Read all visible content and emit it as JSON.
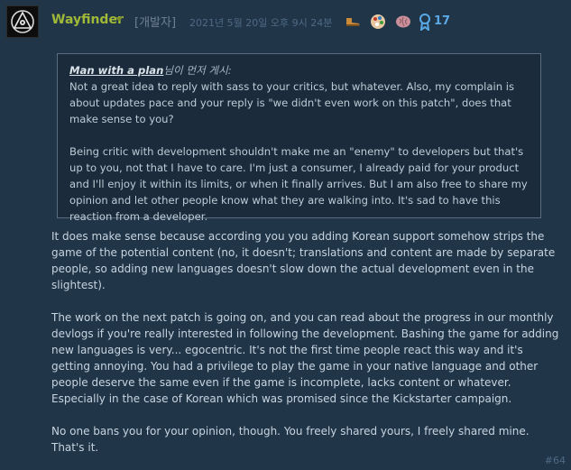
{
  "post": {
    "author": "Wayfinder",
    "role": "[개발자]",
    "date": "2021년 5월 20일 오후 9시 24분",
    "award_count": "17",
    "post_number": "#64"
  },
  "quote": {
    "author": "Man with a plan",
    "suffix": "님이 먼저 게시:",
    "paragraphs": [
      "Not a great idea to reply with sass to your critics, but whatever. Also, my complain is about updates pace and your reply is \"we didn't even work on this patch\", does that make sense to you?",
      "Being critic with development shouldn't make me an \"enemy\" to developers but that's up to you, not that I have to care. I'm just a consumer, I already paid for your product and I'll enjoy it within its limits, or when it finally arrives. But I am also free to share my opinion and let other people know what they are walking into. It's sad to have this reaction from a developer."
    ]
  },
  "body": {
    "paragraphs": [
      "It does make sense because according you you adding Korean support somehow strips the game of the potential content (no, it doesn't; translations and content are made by separate people, so adding new languages doesn't slow down the actual development even in the slightest).",
      "The work on the next patch is going on, and you can read about the progress in our monthly devlogs if you're really interested in following the development. Bashing the game for adding new languages is very... egocentric. It's not the first time people react this way and it's getting annoying. You had a privilege to play the game in your native language and other people deserve the same even if the game is incomplete, lacks content or whatever. Especially in the case of Korean which was promised since the Kickstarter campaign.",
      "No one bans you for your opinion, though. You freely shared yours, I freely shared mine. That's it."
    ]
  },
  "icons": [
    "avatar-emblem-icon",
    "boot-icon",
    "palette-icon",
    "brain-icon",
    "award-ribbon-icon"
  ],
  "colors": {
    "background": "#213549",
    "author": "#a0b936",
    "accent": "#5aa9e6"
  }
}
